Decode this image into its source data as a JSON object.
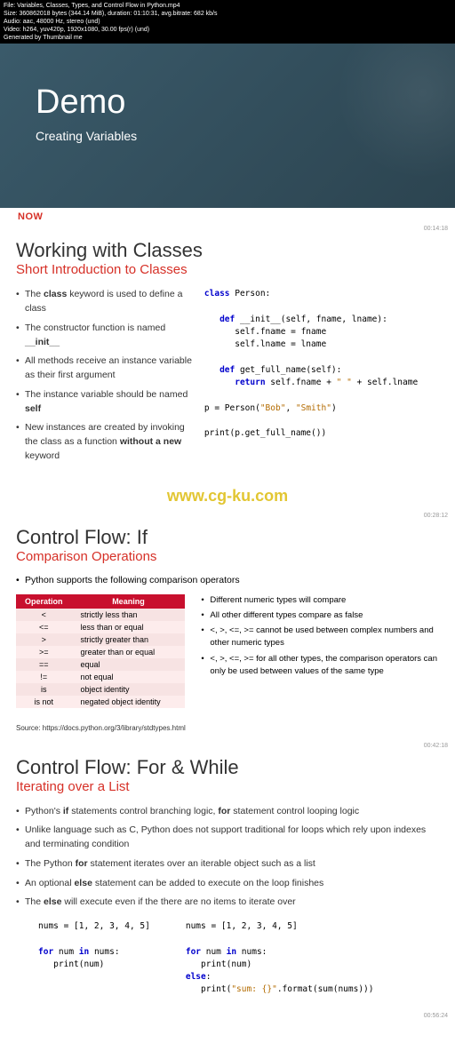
{
  "metadata": {
    "file": "File: Variables, Classes, Types, and Control Flow in Python.mp4",
    "size": "Size: 360862018 bytes (344.14 MiB), duration: 01:10:31, avg.bitrate: 682 kb/s",
    "audio": "Audio: aac, 48000 Hz, stereo (und)",
    "video": "Video: h264, yuv420p, 1920x1080, 30.00 fps(r) (und)",
    "generated": "Generated by Thumbnail me"
  },
  "demo": {
    "title": "Demo",
    "subtitle": "Creating Variables",
    "logo": "NOW",
    "timestamp": "00:14:18"
  },
  "classes": {
    "title": "Working with Classes",
    "subtitle": "Short Introduction to Classes",
    "bullets": [
      "The <b>class</b> keyword is used to define a class",
      "The constructor function is named <b>__init__</b>",
      "All methods receive an instance variable as their first argument",
      "The instance variable should be named <b>self</b>",
      "New instances are created by invoking the class as a function <b>without a new</b> keyword"
    ],
    "timestamp": "00:28:12"
  },
  "watermark": "www.cg-ku.com",
  "controlif": {
    "title": "Control Flow: If",
    "subtitle": "Comparison Operations",
    "lead": "Python supports the following comparison operators",
    "table": {
      "headers": [
        "Operation",
        "Meaning"
      ],
      "rows": [
        [
          "<",
          "strictly less than"
        ],
        [
          "<=",
          "less than or equal"
        ],
        [
          ">",
          "strictly greater than"
        ],
        [
          ">=",
          "greater than or equal"
        ],
        [
          "==",
          "equal"
        ],
        [
          "!=",
          "not equal"
        ],
        [
          "is",
          "object identity"
        ],
        [
          "is not",
          "negated object identity"
        ]
      ]
    },
    "notes": [
      "Different numeric types will compare",
      "All other different types compare as false",
      "<, >, <=, >= cannot be used between complex numbers and other numeric types",
      "<, >, <=, >= for all other types, the comparison operators can only be used between values of the same type"
    ],
    "source": "Source: https://docs.python.org/3/library/stdtypes.html",
    "timestamp": "00:42:18"
  },
  "controlfor": {
    "title": "Control Flow: For & While",
    "subtitle": "Iterating over a List",
    "bullets": [
      "Python's <b>if</b> statements control branching logic, <b>for</b> statement control looping logic",
      "Unlike language such as C, Python does not support traditional for loops which rely upon indexes and terminating condition",
      "The Python <b>for</b> statement iterates over an iterable object such as a list",
      "An optional <b>else</b> statement can be added to execute on the loop finishes",
      "The <b>else</b> will execute even if the there are no items to iterate over"
    ],
    "timestamp": "00:56:24"
  }
}
